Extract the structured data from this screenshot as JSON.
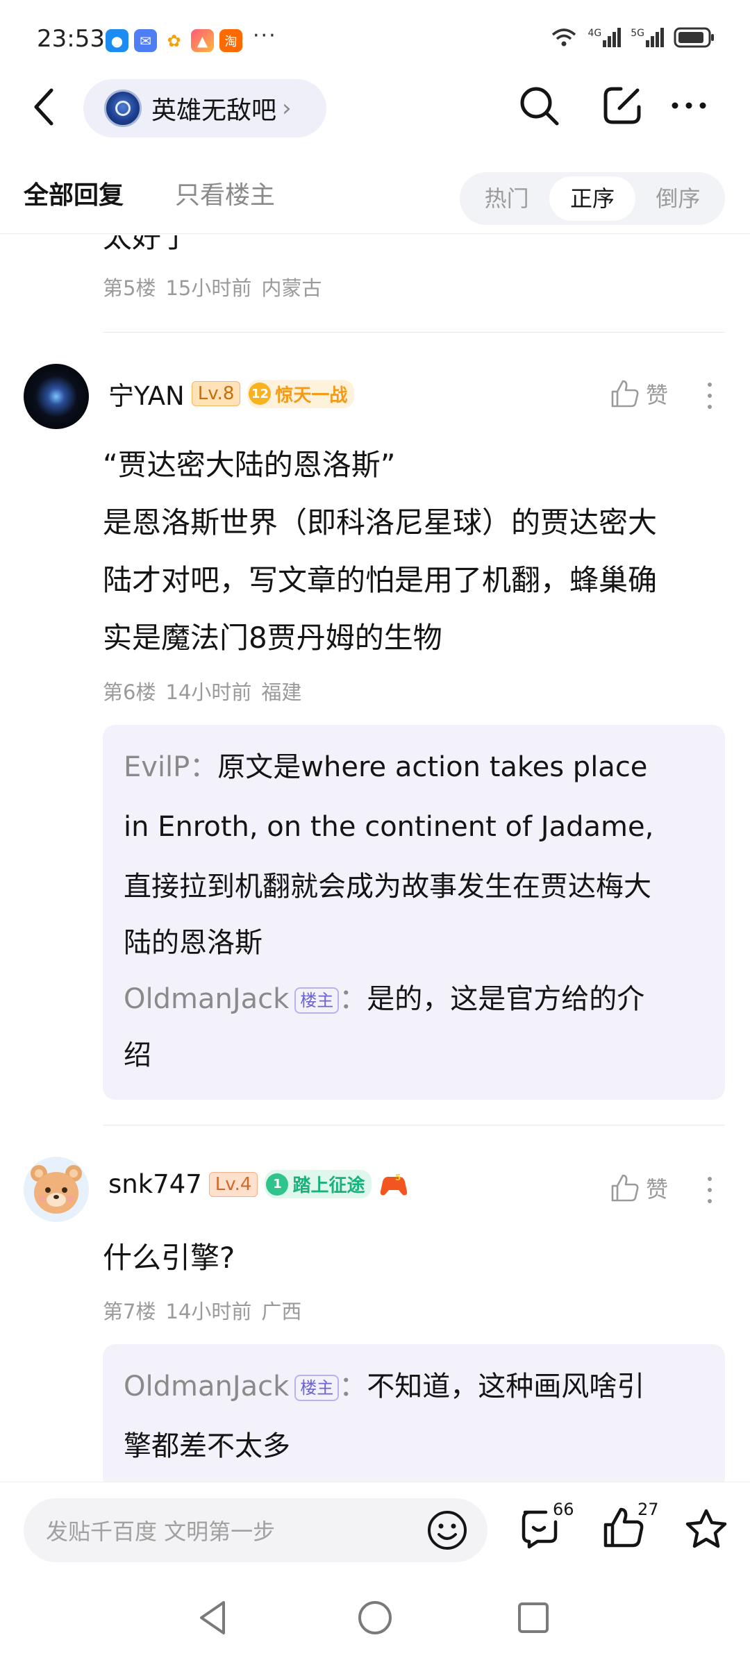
{
  "status_bar": {
    "time": "23:53",
    "dots": "···",
    "net1": "4G",
    "net2": "5G"
  },
  "header": {
    "forum_name": "英雄无敌吧",
    "chevron": "›"
  },
  "tabs": {
    "all_replies": "全部回复",
    "only_op": "只看楼主"
  },
  "sort": {
    "hot": "热门",
    "asc": "正序",
    "desc": "倒序",
    "selected": "正序"
  },
  "prev_post": {
    "text_tail": "太好了",
    "floor": "第5楼",
    "time": "15小时前",
    "location": "内蒙古"
  },
  "posts": [
    {
      "user": "宁YAN",
      "level": "Lv.8",
      "badge_num": "12",
      "badge_title": "惊天一战",
      "like_label": "赞",
      "body": [
        "“贾达密大陆的恩洛斯”",
        "是恩洛斯世界（即科洛尼星球）的贾达密大",
        "陆才对吧，写文章的怕是用了机翻，蜂巢确",
        "实是魔法门8贾丹姆的生物"
      ],
      "floor": "第6楼",
      "time": "14小时前",
      "location": "福建",
      "replies": [
        {
          "user": "EvilP",
          "sep": "：",
          "lines": [
            "原文是where action takes place",
            "in Enroth, on the continent of Jadame,",
            "直接拉到机翻就会成为故事发生在贾达梅大",
            "陆的恩洛斯"
          ]
        },
        {
          "user": "OldmanJack",
          "host_tag": "楼主",
          "sep": "：",
          "lines": [
            "是的，这是官方给的介",
            "绍"
          ]
        }
      ]
    },
    {
      "user": "snk747",
      "level": "Lv.4",
      "badge_num": "1",
      "badge_title": "踏上征途",
      "like_label": "赞",
      "body": [
        "什么引擎?"
      ],
      "floor": "第7楼",
      "time": "14小时前",
      "location": "广西",
      "replies": [
        {
          "user": "OldmanJack",
          "host_tag": "楼主",
          "sep": "：",
          "lines": [
            "不知道，这种画风啥引",
            "擎都差不太多"
          ]
        }
      ]
    }
  ],
  "bottom": {
    "placeholder": "发贴千百度 文明第一步",
    "comment_count": "66",
    "like_count": "27"
  },
  "colors": {
    "accent": "#6b63d4",
    "seg_bg": "#f2f3f7",
    "quote_bg": "#f3f2fa"
  }
}
